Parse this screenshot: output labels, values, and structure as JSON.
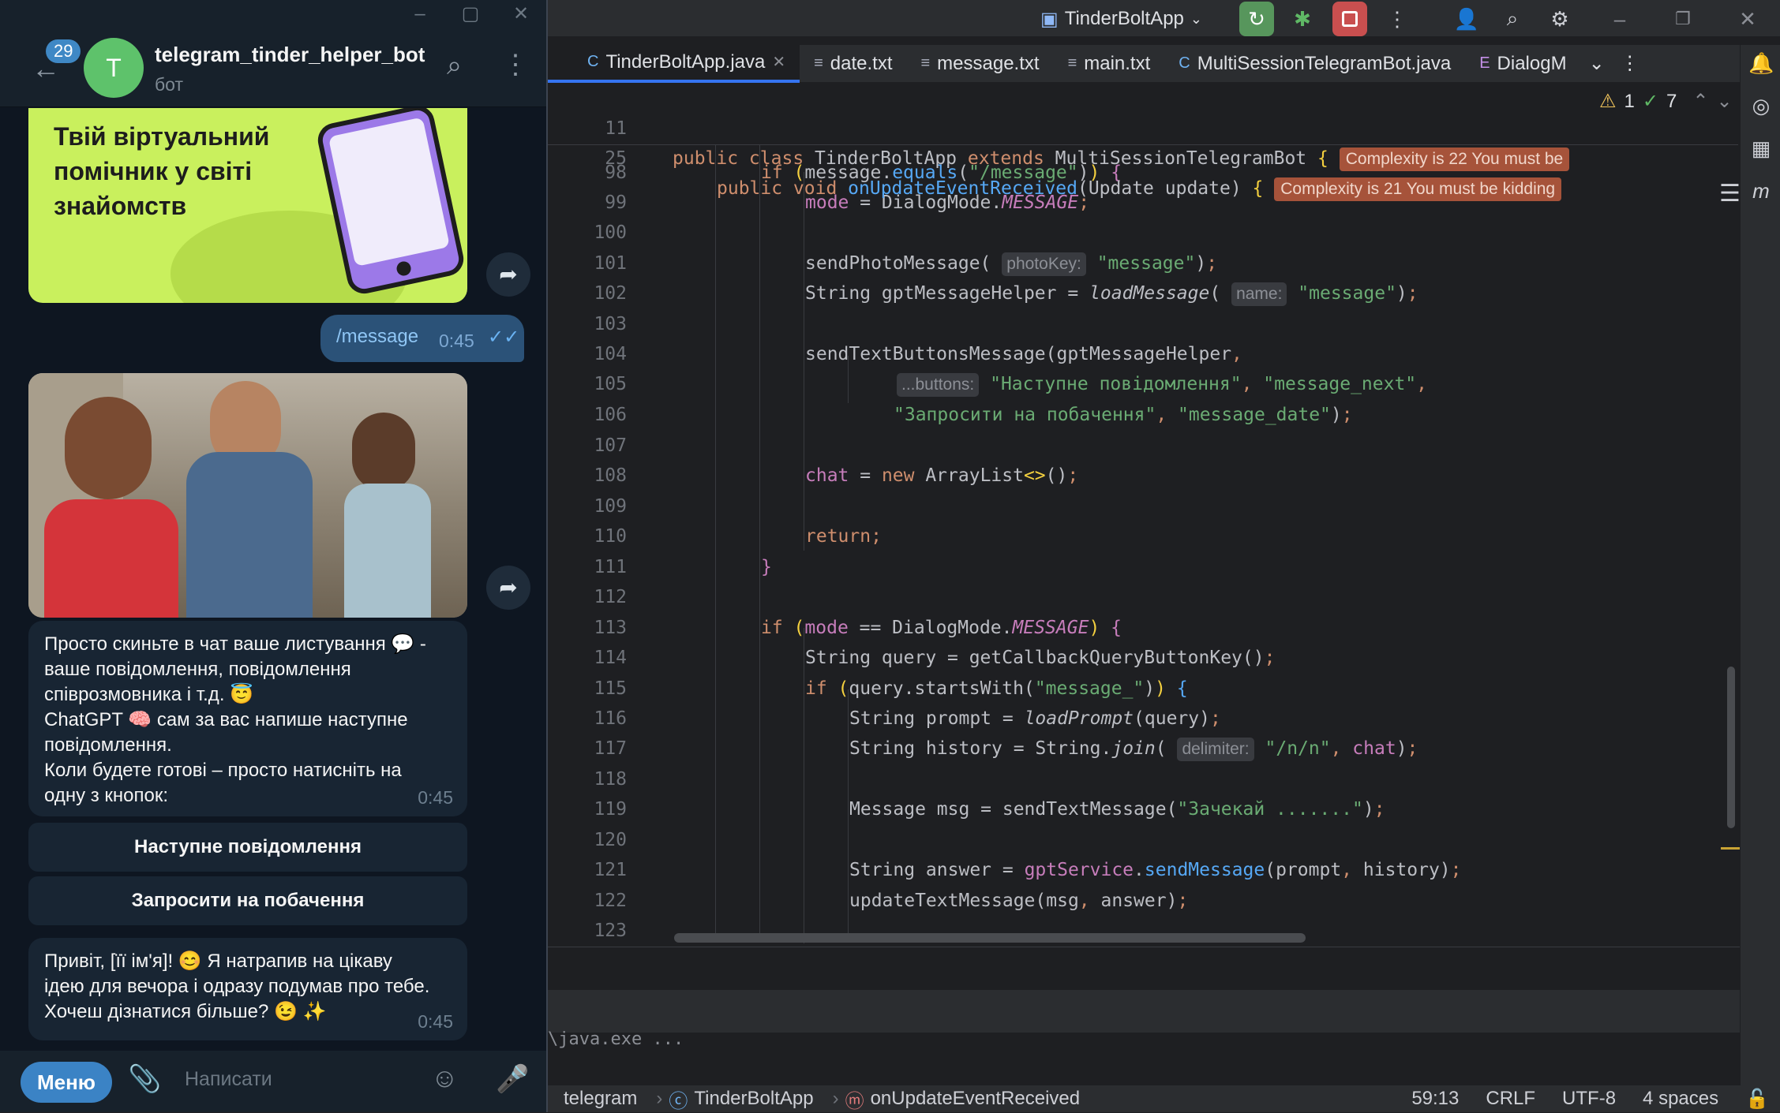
{
  "ide": {
    "run_config": "TinderBoltApp",
    "tabs": [
      {
        "label": "TinderBoltApp.java",
        "icon": "C"
      },
      {
        "label": "date.txt",
        "icon": "≡"
      },
      {
        "label": "message.txt",
        "icon": "≡"
      },
      {
        "label": "main.txt",
        "icon": "≡"
      },
      {
        "label": "MultiSessionTelegramBot.java",
        "icon": "C"
      },
      {
        "label": "DialogM",
        "icon": "E"
      }
    ],
    "inspections": {
      "warnings": "1",
      "ok": "7"
    },
    "sticky": [
      {
        "num": "11",
        "complexity": "Complexity is 22 You must be"
      },
      {
        "num": "25",
        "complexity": "Complexity is 21 You must be kidding"
      }
    ],
    "line_numbers": [
      "98",
      "99",
      "100",
      "101",
      "102",
      "103",
      "104",
      "105",
      "106",
      "107",
      "108",
      "109",
      "110",
      "111",
      "112",
      "113",
      "114",
      "115",
      "116",
      "117",
      "118",
      "119",
      "120",
      "121",
      "122",
      "123"
    ],
    "hints": {
      "photoKey": "photoKey:",
      "name": "name:",
      "buttons": "...buttons:",
      "delimiter": "delimiter:"
    },
    "strings": {
      "message_cmd": "\"/message\"",
      "message": "\"message\"",
      "next_label": "\"Наступне повідомлення\"",
      "message_next": "\"message_next\"",
      "date_label": "\"Запросити на побачення\"",
      "message_date": "\"message_date\"",
      "message_prefix": "\"message_\"",
      "newline": "\"/n/n\"",
      "wait": "\"Зачекай .......\""
    },
    "console": "\\java.exe ...",
    "status": {
      "crumbs": [
        "telegram",
        "TinderBoltApp",
        "onUpdateEventReceived"
      ],
      "position": "59:13",
      "line_sep": "CRLF",
      "encoding": "UTF-8",
      "indent": "4 spaces"
    }
  },
  "telegram": {
    "badge": "29",
    "avatar_letter": "T",
    "bot_name": "telegram_tinder_helper_bot",
    "bot_sub": "бот",
    "promo_lines": [
      "Твій віртуальний",
      "помічник у світі",
      "знайомств"
    ],
    "out_msg": {
      "text": "/message",
      "time": "0:45"
    },
    "msg1_lines": [
      "Просто скиньте в чат ваше листування 💬 -",
      "ваше повідомлення, повідомлення",
      "співрозмовника і т.д. 😇",
      "ChatGPT 🧠 сам за вас напише наступне",
      "повідомлення.",
      "Коли будете готові – просто натисніть на",
      "одну з кнопок:"
    ],
    "msg1_time": "0:45",
    "buttons": [
      "Наступне повідомлення",
      "Запросити на побачення"
    ],
    "msg2_lines": [
      "Привіт, [її ім'я]! 😊 Я натрапив на цікаву",
      "ідею для вечора і одразу подумав про тебе.",
      "Хочеш дізнатися більше? 😉 ✨"
    ],
    "msg2_time": "0:45",
    "menu_label": "Меню",
    "input_placeholder": "Написати"
  }
}
